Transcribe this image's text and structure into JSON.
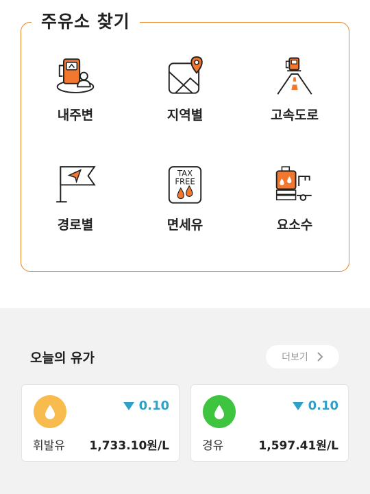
{
  "finder": {
    "title": "주유소 찾기",
    "items": [
      {
        "label": "내주변",
        "icon": "nearby-station-icon"
      },
      {
        "label": "지역별",
        "icon": "map-pin-icon"
      },
      {
        "label": "고속도로",
        "icon": "highway-icon"
      },
      {
        "label": "경로별",
        "icon": "route-flag-icon"
      },
      {
        "label": "면세유",
        "icon": "tax-free-icon"
      },
      {
        "label": "요소수",
        "icon": "urea-truck-icon"
      }
    ],
    "taxfree_badge": {
      "line1": "TAX",
      "line2": "FREE"
    }
  },
  "prices": {
    "title": "오늘의 유가",
    "more_label": "더보기",
    "cards": [
      {
        "name": "휘발유",
        "change": "0.10",
        "price": "1,733.10원/L",
        "color": "#f7bb4e"
      },
      {
        "name": "경유",
        "change": "0.10",
        "price": "1,597.41원/L",
        "color": "#3fc43f"
      }
    ]
  },
  "colors": {
    "accent": "#e8862a",
    "icon_orange": "#f2772f",
    "change_blue": "#2ea1c8"
  }
}
